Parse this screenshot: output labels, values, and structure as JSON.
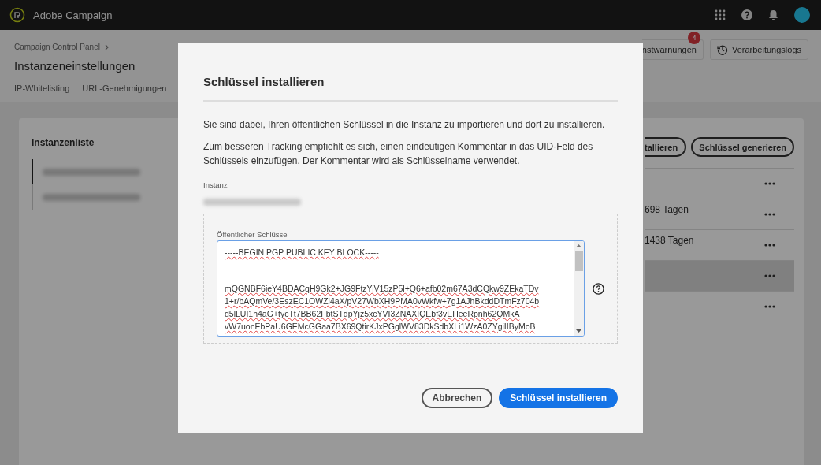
{
  "app": {
    "title": "Adobe Campaign"
  },
  "breadcrumb": "Campaign Control Panel",
  "page_title": "Instanzeneinstellungen",
  "tabs": [
    {
      "label": "IP-Whitelisting",
      "selected": false
    },
    {
      "label": "URL-Genehmigungen",
      "selected": false
    }
  ],
  "header_buttons": [
    {
      "label": "nstwarnungen",
      "badge": "4",
      "kind": "alerts"
    },
    {
      "label": "Verarbeitungslogs",
      "kind": "logs"
    }
  ],
  "instance_list": {
    "title": "Instanzenliste",
    "items": [
      {
        "selected": true
      },
      {
        "selected": false
      }
    ]
  },
  "key_actions": [
    "tallieren",
    "Schlüssel generieren"
  ],
  "key_rows": [
    {
      "selected": false
    },
    {
      "expiry": "698 Tagen",
      "selected": false
    },
    {
      "expiry": "1438 Tagen",
      "selected": false
    },
    {
      "selected": true
    },
    {
      "selected": false
    }
  ],
  "dialog": {
    "title": "Schlüssel installieren",
    "paragraphs": [
      "Sie sind dabei, Ihren öffentlichen Schlüssel in die Instanz zu importieren und dort zu installieren.",
      "Zum besseren Tracking empfiehlt es sich, einen eindeutigen Kommentar in das UID-Feld des Schlüssels einzufügen. Der Kommentar wird als Schlüsselname verwendet."
    ],
    "instance_label": "Instanz",
    "key_label": "Öffentlicher Schlüssel",
    "key_header": "-----BEGIN PGP PUBLIC KEY BLOCK-----",
    "key_lines": [
      "mQGNBF6ieY4BDACqH9Gk2+JG9FtzYiV15zP5l+Q6+afb02m67A3dCQkw9ZEkaTDv",
      "1+r/bAQmVe/3EszEC1OWZi4aX/pV27WbXH9PMA0vWkfw+7g1AJhBkddDTmFz704b",
      "d5lLUI1h4aG+tycTt7BB62FbtSTdpYjz5xcYVI3ZNAXIQEbf3vEHeeRpnh62QMkA",
      "vW7uonEbPaU6GEMcGGaa7BX69QtirKJxPGglWV83DkSdbXLi1WzA0ZYgiIIByMoB"
    ],
    "buttons": [
      {
        "label": "Abbrechen",
        "kind": "secondary"
      },
      {
        "label": "Schlüssel installieren",
        "kind": "primary"
      }
    ]
  }
}
